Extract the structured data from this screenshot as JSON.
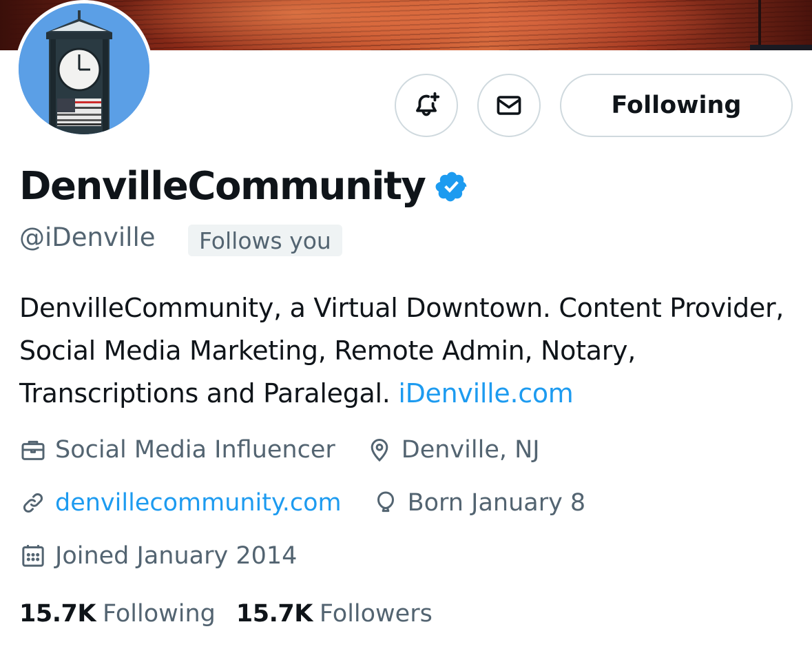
{
  "profile": {
    "display_name": "DenvilleCommunity",
    "handle": "@iDenville",
    "follows_you_badge": "Follows you",
    "bio_text": "DenvilleCommunity, a Virtual Downtown. Content Provider, Social Media Marketing, Remote Admin, Notary, Transcriptions and Paralegal. ",
    "bio_link": "iDenville.com",
    "category": "Social Media Influencer",
    "location": "Denville, NJ",
    "website": "denvillecommunity.com",
    "birthday": "Born January 8",
    "joined": "Joined January 2014"
  },
  "actions": {
    "follow_button": "Following",
    "notify_icon": "bell-plus-icon",
    "message_icon": "envelope-icon"
  },
  "stats": {
    "following_count": "15.7K",
    "following_label": "Following",
    "followers_count": "15.7K",
    "followers_label": "Followers"
  },
  "colors": {
    "link": "#1d9bf0",
    "secondary_text": "#536471",
    "primary_text": "#0f1419",
    "verified": "#1d9bf0"
  }
}
